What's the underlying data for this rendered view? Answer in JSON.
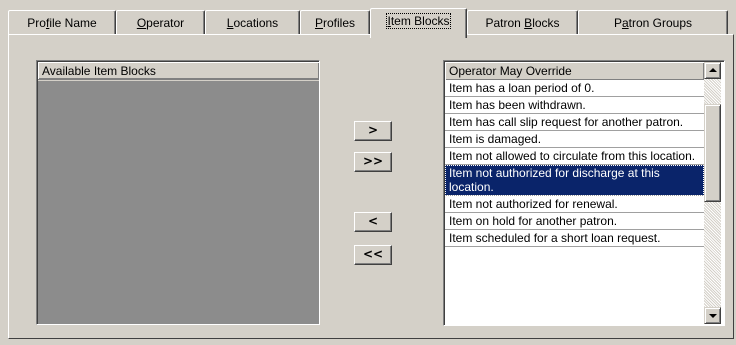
{
  "tabs": [
    {
      "pre": "Pro",
      "mn": "f",
      "post": "ile Name"
    },
    {
      "pre": "",
      "mn": "O",
      "post": "perator"
    },
    {
      "pre": "",
      "mn": "L",
      "post": "ocations"
    },
    {
      "pre": "",
      "mn": "P",
      "post": "rofiles"
    },
    {
      "pre": "",
      "mn": "I",
      "post": "tem Blocks"
    },
    {
      "pre": "Patron ",
      "mn": "B",
      "post": "locks"
    },
    {
      "pre": "P",
      "mn": "a",
      "post": "tron Groups"
    }
  ],
  "active_tab_index": 4,
  "available_list": {
    "header": "Available Item Blocks",
    "items": []
  },
  "buttons": {
    "add": ">",
    "add_all": ">>",
    "remove": "<",
    "remove_all": "<<"
  },
  "override_list": {
    "header": "Operator May Override",
    "items": [
      "Item has a loan period of 0.",
      "Item has been withdrawn.",
      "Item has call slip request for another patron.",
      "Item is damaged.",
      "Item not allowed to circulate from this location.",
      "Item not authorized for discharge at this location.",
      "Item not authorized for renewal.",
      "Item on hold for another patron.",
      "Item scheduled for a short loan request."
    ],
    "selected_index": 5
  },
  "colors": {
    "dialog_bg": "#d4d0c8",
    "selection_bg": "#0a246a",
    "empty_list_bg": "#8c8c8c"
  }
}
